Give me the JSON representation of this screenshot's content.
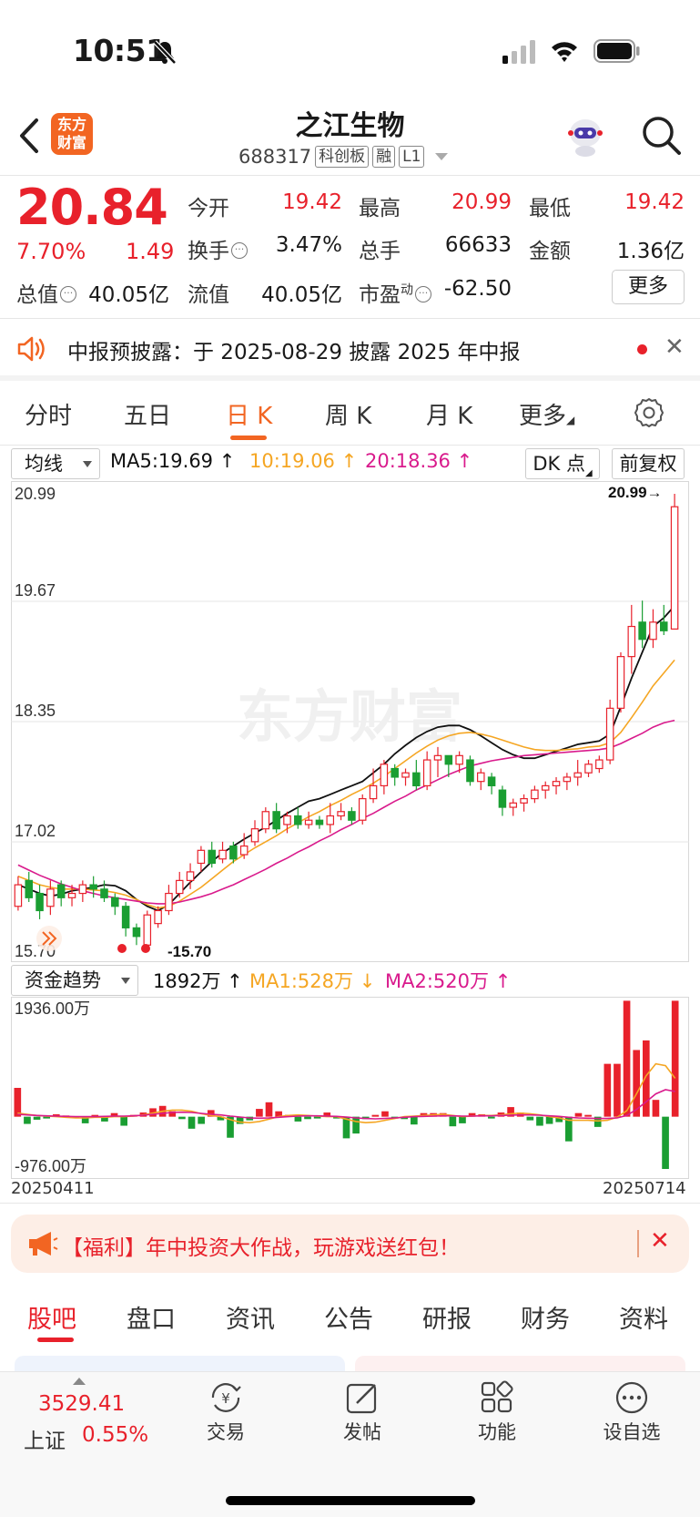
{
  "status": {
    "time": "10:51"
  },
  "header": {
    "logo_line1": "东方",
    "logo_line2": "财富",
    "name": "之江生物",
    "code": "688317",
    "tags": [
      "科创板",
      "融",
      "L1"
    ]
  },
  "quote": {
    "price": "20.84",
    "change_pct": "7.70%",
    "change": "1.49",
    "items": [
      {
        "label": "今开",
        "value": "19.42"
      },
      {
        "label": "最高",
        "value": "20.99"
      },
      {
        "label": "最低",
        "value": "19.42"
      },
      {
        "label": "换手",
        "value": "3.47%"
      },
      {
        "label": "总手",
        "value": "66633"
      },
      {
        "label": "金额",
        "value": "1.36亿"
      },
      {
        "label": "总值",
        "value": "40.05亿"
      },
      {
        "label": "流值",
        "value": "40.05亿"
      },
      {
        "label": "市盈",
        "label_sup": "动",
        "value": "-62.50"
      }
    ],
    "more": "更多"
  },
  "notice": {
    "text": "中报预披露：于 2025-08-29 披露 2025 年中报"
  },
  "period_tabs": [
    "分时",
    "五日",
    "日 K",
    "周 K",
    "月 K",
    "更多"
  ],
  "active_period": "日 K",
  "ma_row": {
    "dropdown": "均线",
    "ma5": "MA5:19.69",
    "ma10": "10:19.06",
    "ma20": "20:18.36",
    "dk": "DK 点",
    "adjust": "前复权"
  },
  "vol_row": {
    "dropdown": "资金趋势",
    "value": "1892万",
    "ma1": "MA1:528万",
    "ma2": "MA2:520万"
  },
  "colors": {
    "up": "#e8212b",
    "down": "#1a9e32",
    "ma5": "#111111",
    "ma10": "#f5a623",
    "ma20": "#d91a8c",
    "accent": "#f26522"
  },
  "chart_data": [
    {
      "type": "candlestick",
      "y_ticks": [
        "20.99",
        "19.67",
        "18.35",
        "17.02",
        "15.70"
      ],
      "ylim": [
        15.7,
        20.99
      ],
      "annotations": {
        "max": "20.99",
        "min": "15.70"
      },
      "watermark": "东方财富",
      "series": [
        {
          "name": "MA5",
          "values": [
            16.45,
            16.4,
            16.35,
            16.32,
            16.34,
            16.38,
            16.4,
            16.42,
            16.45,
            16.44,
            16.38,
            16.28,
            16.2,
            16.15,
            16.22,
            16.35,
            16.48,
            16.6,
            16.72,
            16.82,
            16.9,
            16.98,
            17.05,
            17.12,
            17.2,
            17.28,
            17.35,
            17.42,
            17.45,
            17.5,
            17.55,
            17.6,
            17.65,
            17.75,
            17.85,
            17.97,
            18.07,
            18.16,
            18.23,
            18.28,
            18.3,
            18.3,
            18.25,
            18.18,
            18.1,
            18.02,
            17.96,
            17.92,
            17.92,
            17.96,
            18,
            18.04,
            18.08,
            18.1,
            18.12,
            18.2,
            18.52,
            18.85,
            19.15,
            19.45,
            19.55,
            19.69
          ]
        },
        {
          "name": "MA10",
          "values": [
            16.55,
            16.5,
            16.45,
            16.42,
            16.4,
            16.4,
            16.4,
            16.39,
            16.38,
            16.36,
            16.33,
            16.28,
            16.22,
            16.18,
            16.2,
            16.26,
            16.34,
            16.42,
            16.52,
            16.62,
            16.72,
            16.8,
            16.88,
            16.95,
            17.02,
            17.1,
            17.17,
            17.24,
            17.3,
            17.37,
            17.43,
            17.5,
            17.56,
            17.63,
            17.71,
            17.8,
            17.89,
            17.98,
            18.06,
            18.13,
            18.18,
            18.21,
            18.22,
            18.2,
            18.17,
            18.13,
            18.09,
            18.05,
            18.02,
            18.01,
            18.01,
            18.02,
            18.03,
            18.05,
            18.06,
            18.1,
            18.22,
            18.39,
            18.57,
            18.76,
            18.91,
            19.06
          ]
        },
        {
          "name": "MA20",
          "values": [
            16.68,
            16.62,
            16.56,
            16.51,
            16.46,
            16.42,
            16.38,
            16.35,
            16.32,
            16.3,
            16.28,
            16.26,
            16.24,
            16.23,
            16.23,
            16.25,
            16.28,
            16.31,
            16.35,
            16.4,
            16.45,
            16.51,
            16.57,
            16.63,
            16.7,
            16.76,
            16.83,
            16.89,
            16.96,
            17.02,
            17.09,
            17.15,
            17.22,
            17.28,
            17.35,
            17.42,
            17.48,
            17.55,
            17.61,
            17.67,
            17.73,
            17.78,
            17.83,
            17.86,
            17.89,
            17.91,
            17.93,
            17.95,
            17.96,
            17.97,
            17.98,
            17.99,
            18,
            18.01,
            18.02,
            18.04,
            18.09,
            18.15,
            18.21,
            18.28,
            18.33,
            18.36
          ]
        }
      ],
      "candles": [
        [
          16.2,
          16.45,
          16.15,
          16.55
        ],
        [
          16.5,
          16.3,
          16.25,
          16.6
        ],
        [
          16.35,
          16.15,
          16.05,
          16.45
        ],
        [
          16.2,
          16.4,
          16.1,
          16.5
        ],
        [
          16.45,
          16.3,
          16.2,
          16.5
        ],
        [
          16.3,
          16.35,
          16.2,
          16.45
        ],
        [
          16.35,
          16.45,
          16.25,
          16.5
        ],
        [
          16.45,
          16.4,
          16.3,
          16.55
        ],
        [
          16.4,
          16.3,
          16.25,
          16.5
        ],
        [
          16.3,
          16.2,
          16.1,
          16.35
        ],
        [
          16.2,
          15.95,
          15.85,
          16.25
        ],
        [
          15.95,
          15.85,
          15.75,
          16.0
        ],
        [
          15.75,
          16.1,
          15.7,
          16.15
        ],
        [
          16.0,
          16.15,
          15.95,
          16.2
        ],
        [
          16.15,
          16.35,
          16.1,
          16.45
        ],
        [
          16.35,
          16.5,
          16.3,
          16.6
        ],
        [
          16.5,
          16.6,
          16.4,
          16.7
        ],
        [
          16.7,
          16.85,
          16.6,
          16.9
        ],
        [
          16.85,
          16.7,
          16.65,
          16.95
        ],
        [
          16.75,
          16.85,
          16.7,
          16.95
        ],
        [
          16.9,
          16.75,
          16.7,
          16.95
        ],
        [
          16.8,
          16.9,
          16.75,
          17.05
        ],
        [
          16.95,
          17.1,
          16.9,
          17.2
        ],
        [
          17.1,
          17.3,
          17.05,
          17.35
        ],
        [
          17.3,
          17.1,
          17.05,
          17.4
        ],
        [
          17.15,
          17.25,
          17.05,
          17.3
        ],
        [
          17.25,
          17.15,
          17.1,
          17.35
        ],
        [
          17.15,
          17.2,
          17.1,
          17.3
        ],
        [
          17.2,
          17.15,
          17.1,
          17.25
        ],
        [
          17.15,
          17.25,
          17.05,
          17.4
        ],
        [
          17.25,
          17.3,
          17.2,
          17.4
        ],
        [
          17.3,
          17.2,
          17.15,
          17.35
        ],
        [
          17.2,
          17.45,
          17.15,
          17.5
        ],
        [
          17.45,
          17.6,
          17.4,
          17.8
        ],
        [
          17.6,
          17.85,
          17.5,
          17.9
        ],
        [
          17.8,
          17.7,
          17.6,
          17.85
        ],
        [
          17.7,
          17.75,
          17.6,
          17.8
        ],
        [
          17.75,
          17.6,
          17.55,
          17.9
        ],
        [
          17.6,
          17.9,
          17.55,
          18.0
        ],
        [
          17.9,
          17.95,
          17.7,
          18.05
        ],
        [
          17.95,
          17.85,
          17.7,
          17.95
        ],
        [
          17.85,
          17.95,
          17.75,
          18.0
        ],
        [
          17.9,
          17.65,
          17.6,
          17.95
        ],
        [
          17.65,
          17.75,
          17.55,
          17.8
        ],
        [
          17.7,
          17.6,
          17.5,
          17.75
        ],
        [
          17.55,
          17.35,
          17.25,
          17.6
        ],
        [
          17.35,
          17.4,
          17.25,
          17.45
        ],
        [
          17.4,
          17.45,
          17.3,
          17.5
        ],
        [
          17.45,
          17.55,
          17.4,
          17.6
        ],
        [
          17.55,
          17.6,
          17.45,
          17.65
        ],
        [
          17.6,
          17.65,
          17.5,
          17.7
        ],
        [
          17.65,
          17.7,
          17.55,
          17.75
        ],
        [
          17.7,
          17.75,
          17.6,
          17.9
        ],
        [
          17.75,
          17.85,
          17.7,
          17.9
        ],
        [
          17.8,
          17.9,
          17.75,
          17.95
        ],
        [
          17.9,
          18.5,
          17.85,
          18.6
        ],
        [
          18.5,
          19.1,
          18.45,
          19.15
        ],
        [
          19.1,
          19.45,
          18.9,
          19.7
        ],
        [
          19.5,
          19.3,
          19.2,
          19.75
        ],
        [
          19.3,
          19.5,
          19.2,
          19.65
        ],
        [
          19.5,
          19.4,
          19.35,
          19.7
        ],
        [
          19.42,
          20.84,
          19.42,
          20.99
        ]
      ]
    },
    {
      "type": "bar",
      "y_ticks": [
        "1936.00万",
        "-976.00万"
      ],
      "ylim": [
        -976.0,
        1936.0
      ],
      "x_ticks": [
        "20250411",
        "20250714"
      ],
      "values": [
        480,
        -120,
        -50,
        -30,
        40,
        20,
        -20,
        -110,
        30,
        -80,
        60,
        -150,
        30,
        70,
        140,
        180,
        90,
        -40,
        -200,
        -120,
        110,
        -60,
        -350,
        -120,
        -60,
        130,
        240,
        90,
        30,
        -80,
        -40,
        -30,
        70,
        -30,
        -360,
        -280,
        -40,
        30,
        90,
        -30,
        -40,
        -130,
        60,
        60,
        60,
        -160,
        -110,
        60,
        40,
        -30,
        70,
        160,
        70,
        -60,
        -150,
        -120,
        -90,
        -410,
        60,
        30,
        -170,
        880,
        880,
        1930,
        1110,
        1270,
        280,
        -870,
        1930
      ],
      "series": [
        {
          "name": "MA1",
          "values": [
            60,
            40,
            20,
            10,
            0,
            -10,
            -20,
            -20,
            -10,
            -10,
            0,
            0,
            10,
            30,
            60,
            90,
            110,
            110,
            90,
            50,
            20,
            0,
            -50,
            -90,
            -100,
            -80,
            -40,
            0,
            20,
            30,
            20,
            10,
            0,
            0,
            -40,
            -80,
            -100,
            -90,
            -60,
            -30,
            0,
            10,
            20,
            30,
            40,
            20,
            0,
            10,
            20,
            20,
            30,
            50,
            60,
            50,
            30,
            0,
            -20,
            -60,
            -60,
            -60,
            -70,
            -60,
            -10,
            100,
            380,
            680,
            880,
            850,
            640
          ]
        },
        {
          "name": "MA2",
          "values": [
            40,
            30,
            20,
            15,
            10,
            5,
            0,
            0,
            0,
            5,
            10,
            10,
            15,
            25,
            40,
            55,
            70,
            75,
            70,
            55,
            40,
            30,
            10,
            -5,
            -20,
            -25,
            -20,
            -10,
            0,
            10,
            15,
            15,
            10,
            5,
            -5,
            -20,
            -30,
            -35,
            -30,
            -20,
            -10,
            0,
            5,
            10,
            15,
            15,
            10,
            10,
            15,
            15,
            20,
            25,
            30,
            30,
            25,
            15,
            5,
            -10,
            -20,
            -25,
            -30,
            -30,
            -20,
            20,
            120,
            250,
            380,
            450,
            420
          ]
        }
      ]
    }
  ],
  "promo": {
    "text": "【福利】年中投资大作战，玩游戏送红包！"
  },
  "section_tabs": [
    "股吧",
    "盘口",
    "资讯",
    "公告",
    "研报",
    "财务",
    "资料"
  ],
  "active_section": "股吧",
  "bottom_nav": {
    "index_value": "3529.41",
    "index_name": "上证",
    "index_pct": "0.55%",
    "items": [
      "交易",
      "发帖",
      "功能",
      "设自选"
    ]
  }
}
